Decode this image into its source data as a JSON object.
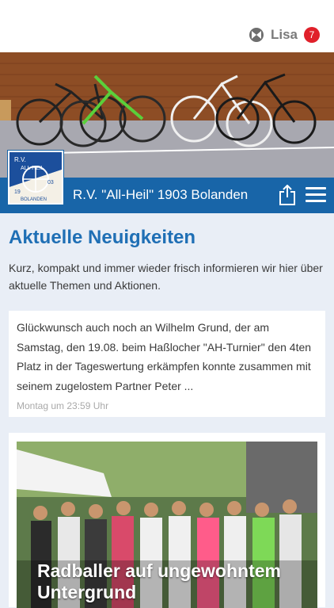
{
  "header": {
    "user_name": "Lisa",
    "notification_count": "7"
  },
  "club": {
    "title": "R.V. \"All-Heil\" 1903 Bolanden",
    "logo_text_top": "R.V. ALL HEIL",
    "logo_text_year_left": "19",
    "logo_text_year_right": "03",
    "logo_text_bottom": "BOLANDEN"
  },
  "news": {
    "heading": "Aktuelle Neuigkeiten",
    "intro": "Kurz, kompakt und immer wieder frisch informieren wir hier über aktuelle Themen und Aktionen.",
    "items": [
      {
        "text": "Glückwunsch auch noch an Wilhelm Grund, der am Samstag, den 19.08. beim Haßlocher \"AH-Turnier\" den 4ten Platz in der Tageswertung erkämpfen konnte zusammen mit seinem zugelostem Partner Peter ...",
        "time": "Montag um 23:59 Uhr"
      },
      {
        "title": "Radballer auf ungewohntem Untergrund"
      }
    ]
  },
  "colors": {
    "brand_blue": "#1865a8",
    "heading_blue": "#1f6fb5",
    "badge_red": "#e0202a",
    "page_bg": "#e9eef6"
  },
  "icons": {
    "user": "user-avatar-icon",
    "share": "share-icon",
    "menu": "hamburger-menu-icon"
  }
}
